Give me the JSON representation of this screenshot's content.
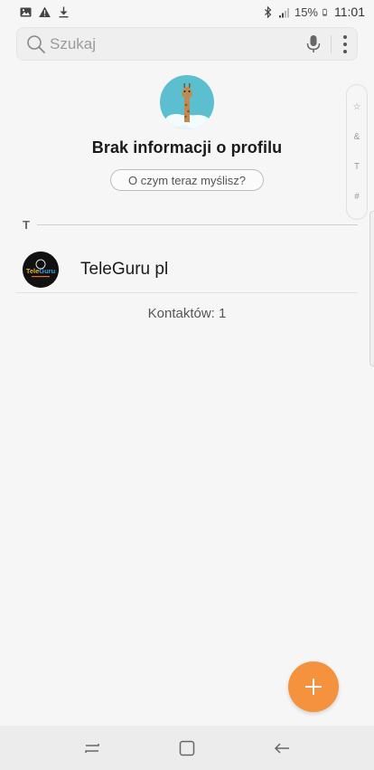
{
  "status_bar": {
    "battery": "15%",
    "time": "11:01",
    "left_icons": [
      "image-icon",
      "warning-icon",
      "download-icon"
    ],
    "right_icons": [
      "bluetooth-icon",
      "signal-icon",
      "battery-icon"
    ]
  },
  "search": {
    "placeholder": "Szukaj",
    "value": ""
  },
  "profile": {
    "title": "Brak informacji o profilu",
    "status_prompt": "O czym teraz myślisz?"
  },
  "index_scroller": {
    "items": [
      "☆",
      "&",
      "T",
      "#"
    ]
  },
  "contacts": {
    "section_letter": "T",
    "items": [
      {
        "name": "TeleGuru pl",
        "avatar_text": "TeleGuru"
      }
    ],
    "count_label": "Kontaktów: 1"
  },
  "fab": {
    "label": "+"
  },
  "colors": {
    "accent": "#f5923e",
    "background": "#f6f6f6",
    "avatar_sky": "#5bbfcf"
  }
}
